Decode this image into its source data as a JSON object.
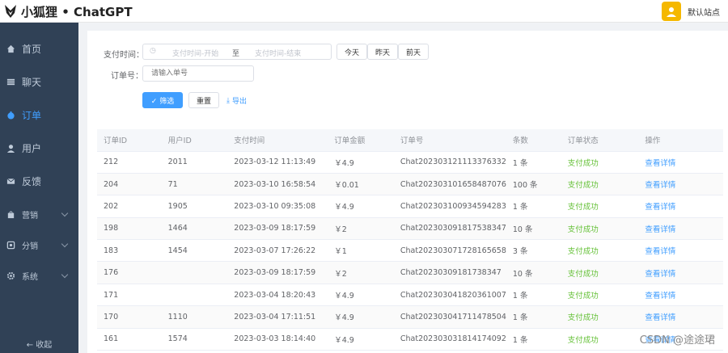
{
  "header": {
    "brand": "小狐狸 • ChatGPT",
    "site_name": "默认站点"
  },
  "sidebar": {
    "items": [
      {
        "label": "首页",
        "icon": "home-icon"
      },
      {
        "label": "聊天",
        "icon": "menu-icon"
      },
      {
        "label": "订单",
        "icon": "order-icon",
        "active": true
      },
      {
        "label": "用户",
        "icon": "user-icon"
      },
      {
        "label": "反馈",
        "icon": "mail-icon"
      },
      {
        "label": "营销",
        "icon": "bag-icon"
      },
      {
        "label": "分销",
        "icon": "share-icon"
      },
      {
        "label": "系统",
        "icon": "gear-icon"
      }
    ],
    "collapse_label": "← 收起"
  },
  "filters": {
    "pay_time_label": "支付时间：",
    "start_placeholder": "支付时间-开始",
    "range_sep": "至",
    "end_placeholder": "支付时间-结束",
    "today": "今天",
    "yesterday": "昨天",
    "day_before": "前天",
    "order_no_label": "订单号：",
    "order_no_placeholder": "请输入单号",
    "search": "✓ 筛选",
    "reset": "重置",
    "export": "导出"
  },
  "table": {
    "columns": [
      "订单ID",
      "用户ID",
      "支付时间",
      "订单金额",
      "订单号",
      "条数",
      "订单状态",
      "操作"
    ],
    "rows": [
      [
        "212",
        "2011",
        "2023-03-12 11:13:49",
        "￥4.9",
        "Chat20230312111337633​2",
        "1 条",
        "支付成功",
        "查看详情"
      ],
      [
        "204",
        "71",
        "2023-03-10 16:58:54",
        "￥0.01",
        "Chat20230310165848707​6",
        "100 条",
        "支付成功",
        "查看详情"
      ],
      [
        "202",
        "1905",
        "2023-03-10 09:35:08",
        "￥4.9",
        "Chat20230310093459428​3",
        "1 条",
        "支付成功",
        "查看详情"
      ],
      [
        "198",
        "1464",
        "2023-03-09 18:17:59",
        "￥2",
        "Chat20230309181753834​7",
        "10 条",
        "支付成功",
        "查看详情"
      ],
      [
        "183",
        "1454",
        "2023-03-07 17:26:22",
        "￥1",
        "Chat20230307172816565​8",
        "3 条",
        "支付成功",
        "查看详情"
      ],
      [
        "176",
        "",
        "2023-03-09 18:17:59",
        "￥2",
        "Chat20230309181738347",
        "10 条",
        "支付成功",
        "查看详情"
      ],
      [
        "171",
        "",
        "2023-03-04 18:20:43",
        "￥4.9",
        "Chat20230304182036100​7",
        "1 条",
        "支付成功",
        "查看详情"
      ],
      [
        "170",
        "1110",
        "2023-03-04 17:11:51",
        "￥4.9",
        "Chat20230304171147850​4",
        "1 条",
        "支付成功",
        "查看详情"
      ],
      [
        "161",
        "1574",
        "2023-03-03 18:14:40",
        "￥4.9",
        "Chat20230303181417409​2",
        "1 条",
        "支付成功",
        "查看详情"
      ]
    ]
  },
  "watermark": "CSDN @途途珺",
  "colors": {
    "sidebar_bg": "#304156",
    "primary": "#409eff",
    "success": "#67c23a",
    "avatar": "#f5b800"
  }
}
